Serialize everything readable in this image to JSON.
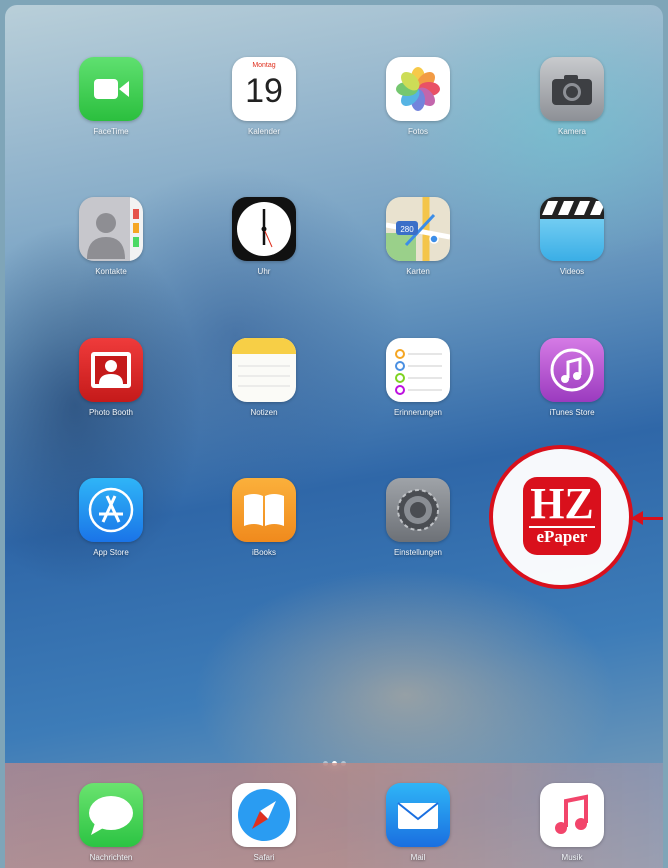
{
  "apps": {
    "facetime": "FaceTime",
    "kalender": "Kalender",
    "kalender_day": "Montag",
    "kalender_date": "19",
    "fotos": "Fotos",
    "kamera": "Kamera",
    "kontakte": "Kontakte",
    "uhr": "Uhr",
    "karten": "Karten",
    "karten_shield": "280",
    "videos": "Videos",
    "photo_booth": "Photo Booth",
    "notizen": "Notizen",
    "erinnerungen": "Erinnerungen",
    "itunes_store": "iTunes Store",
    "app_store": "App Store",
    "ibooks": "iBooks",
    "einstellungen": "Einstellungen"
  },
  "highlight": {
    "title": "HZ",
    "subtitle": "ePaper",
    "ring_color": "#d9101c"
  },
  "dock": {
    "nachrichten": "Nachrichten",
    "safari": "Safari",
    "mail": "Mail",
    "musik": "Musik"
  },
  "page_indicator": {
    "pages": 3,
    "current": 1
  }
}
